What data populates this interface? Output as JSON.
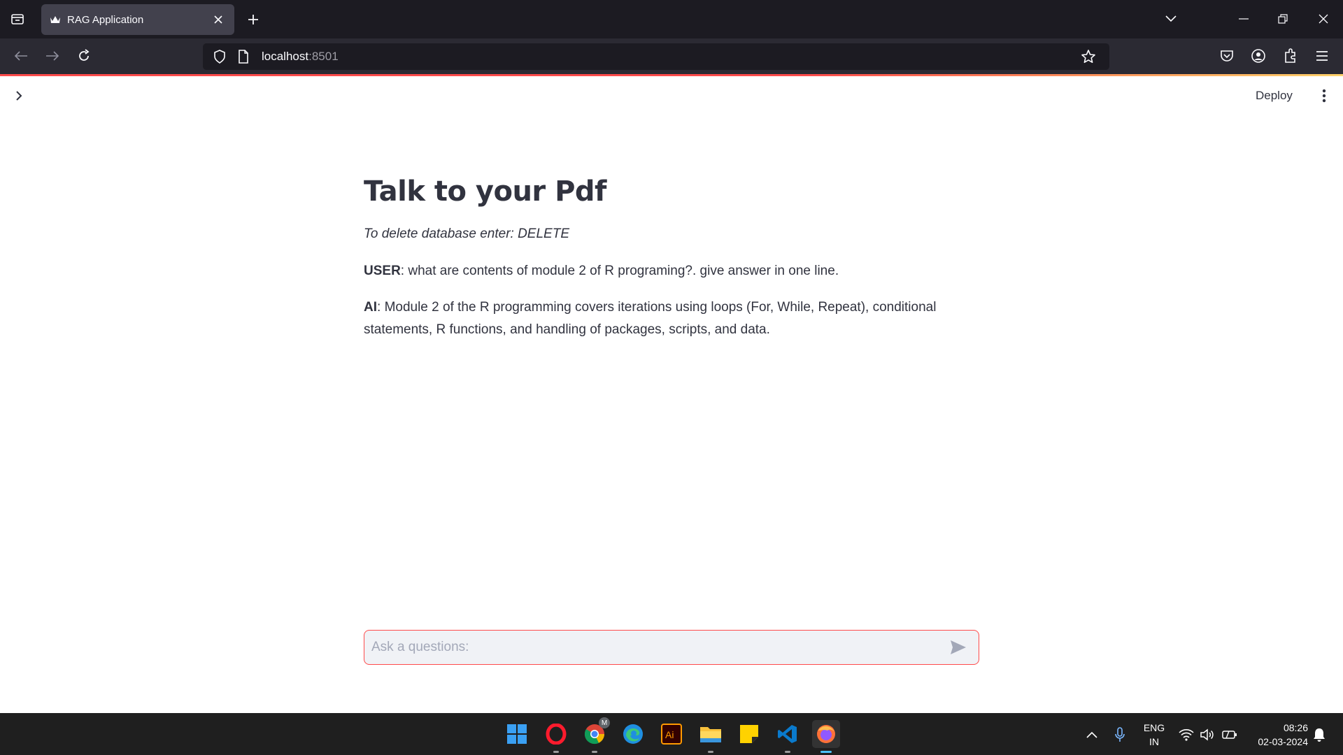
{
  "browser": {
    "tab_title": "RAG Application",
    "url_host": "localhost",
    "url_port": ":8501"
  },
  "header": {
    "deploy_label": "Deploy"
  },
  "main": {
    "title": "Talk to your Pdf",
    "caption": "To delete database enter: DELETE",
    "messages": [
      {
        "role": "USER",
        "sep": ": ",
        "text": "what are contents of module 2 of R programing?. give answer in one line."
      },
      {
        "role": "AI",
        "sep": ": ",
        "text": "Module 2 of the R programming covers iterations using loops (For, While, Repeat), conditional statements, R functions, and handling of packages, scripts, and data."
      }
    ]
  },
  "chat": {
    "placeholder": "Ask a questions:"
  },
  "taskbar": {
    "apps": [
      "start-icon",
      "opera-icon",
      "chrome-icon",
      "edge-icon",
      "illustrator-icon",
      "file-explorer-icon",
      "sticky-notes-icon",
      "vscode-icon",
      "firefox-icon"
    ],
    "chrome_badge": "M",
    "lang_line1": "ENG",
    "lang_line2": "IN",
    "time": "08:26",
    "date": "02-03-2024"
  },
  "colors": {
    "accent": "#ff4b4b",
    "text": "#31333f",
    "input_bg": "#f0f2f6"
  }
}
